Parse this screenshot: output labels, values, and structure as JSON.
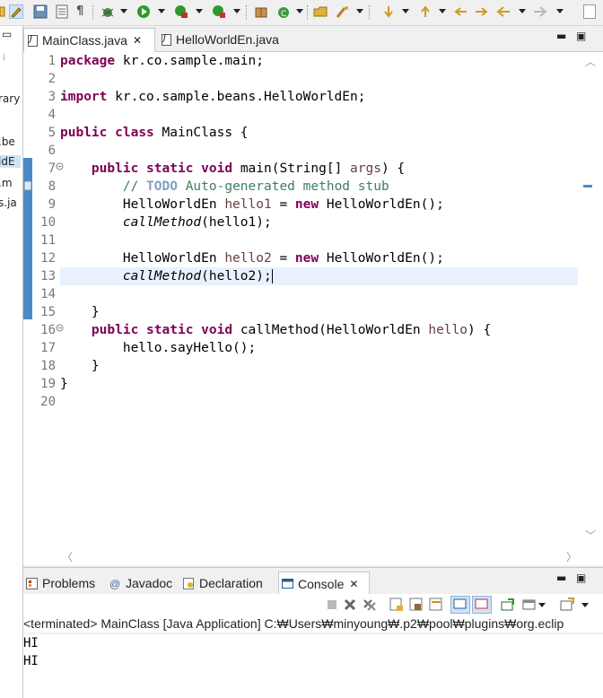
{
  "toolbar": {
    "icons": [
      "new-icon",
      "brush-icon",
      "save-icon",
      "print-icon",
      "pilcrow-icon",
      "debug-icon",
      "run-icon",
      "coverage-icon",
      "external-tools-icon",
      "package-icon",
      "new-class-icon",
      "open-type-icon",
      "search-icon",
      "next-annotation-icon",
      "prev-annotation-icon",
      "last-edit-icon",
      "back-icon",
      "forward-icon"
    ]
  },
  "left_strip": {
    "lines": [
      "rary",
      ".be",
      "ldE",
      ".m",
      "s.ja"
    ]
  },
  "editor": {
    "tabs": [
      {
        "label": "MainClass.java",
        "close": "✕",
        "active": true
      },
      {
        "label": "HelloWorldEn.java",
        "active": false
      }
    ],
    "line_numbers": [
      "1",
      "2",
      "3",
      "4",
      "5",
      "6",
      "7",
      "8",
      "9",
      "10",
      "11",
      "12",
      "13",
      "14",
      "15",
      "16",
      "17",
      "18",
      "19",
      "20"
    ],
    "lines": [
      [
        {
          "t": "package",
          "c": "kw"
        },
        {
          "t": " kr.co.sample.main;"
        }
      ],
      [],
      [
        {
          "t": "import",
          "c": "kw"
        },
        {
          "t": " kr.co.sample.beans.HelloWorldEn;"
        }
      ],
      [],
      [
        {
          "t": "public",
          "c": "kw"
        },
        {
          "t": " "
        },
        {
          "t": "class",
          "c": "kw"
        },
        {
          "t": " MainClass {"
        }
      ],
      [],
      [
        {
          "t": "    "
        },
        {
          "t": "public",
          "c": "kw"
        },
        {
          "t": " "
        },
        {
          "t": "static",
          "c": "kw"
        },
        {
          "t": " "
        },
        {
          "t": "void",
          "c": "kw"
        },
        {
          "t": " main(String[] "
        },
        {
          "t": "args",
          "c": "var"
        },
        {
          "t": ") {"
        }
      ],
      [
        {
          "t": "        "
        },
        {
          "t": "// ",
          "c": "cm"
        },
        {
          "t": "TODO",
          "c": "todo"
        },
        {
          "t": " Auto-generated method stub",
          "c": "cm"
        }
      ],
      [
        {
          "t": "        HelloWorldEn "
        },
        {
          "t": "hello1",
          "c": "var"
        },
        {
          "t": " = "
        },
        {
          "t": "new",
          "c": "kw"
        },
        {
          "t": " HelloWorldEn();"
        }
      ],
      [
        {
          "t": "        "
        },
        {
          "t": "callMethod",
          "c": "it"
        },
        {
          "t": "(hello1);"
        }
      ],
      [],
      [
        {
          "t": "        HelloWorldEn "
        },
        {
          "t": "hello2",
          "c": "var"
        },
        {
          "t": " = "
        },
        {
          "t": "new",
          "c": "kw"
        },
        {
          "t": " HelloWorldEn();"
        }
      ],
      [
        {
          "t": "        "
        },
        {
          "t": "callMethod",
          "c": "it"
        },
        {
          "t": "(hello2);"
        }
      ],
      [],
      [
        {
          "t": "    }"
        }
      ],
      [
        {
          "t": "    "
        },
        {
          "t": "public",
          "c": "kw"
        },
        {
          "t": " "
        },
        {
          "t": "static",
          "c": "kw"
        },
        {
          "t": " "
        },
        {
          "t": "void",
          "c": "kw"
        },
        {
          "t": " callMethod(HelloWorldEn "
        },
        {
          "t": "hello",
          "c": "var"
        },
        {
          "t": ") {"
        }
      ],
      [
        {
          "t": "        hello.sayHello();"
        }
      ],
      [
        {
          "t": "    }"
        }
      ],
      [
        {
          "t": "}"
        }
      ],
      []
    ],
    "current_line": 13,
    "fold_lines": [
      7,
      16
    ]
  },
  "bottom_panel": {
    "tabs": [
      {
        "label": "Problems",
        "icon": "problems-icon",
        "active": false
      },
      {
        "label": "Javadoc",
        "icon": "at-icon",
        "active": false
      },
      {
        "label": "Declaration",
        "icon": "declaration-icon",
        "active": false
      },
      {
        "label": "Console",
        "icon": "console-icon",
        "close": "✕",
        "active": true
      }
    ],
    "console_header": "<terminated> MainClass [Java Application] C:₩Users₩minyoung₩.p2₩pool₩plugins₩org.eclip",
    "output": [
      "HI",
      "HI"
    ]
  },
  "colors": {
    "keyword": "#7f0055",
    "variable": "#6a3e3e",
    "comment": "#3f7f5f",
    "todo": "#7f9fbf",
    "current_line": "#e8f2fe",
    "gutter_marker": "#4a8ac8"
  }
}
